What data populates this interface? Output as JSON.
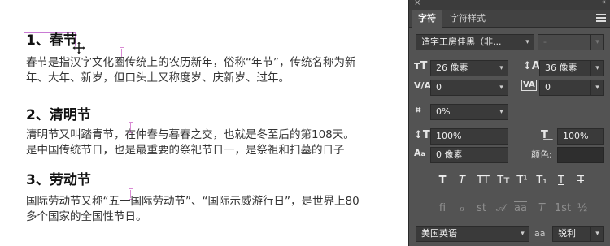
{
  "document": {
    "heading1": "1、春节",
    "para1": "春节是指汉字文化圈传统上的农历新年，俗称“年节”，传统名称为新\n年、大年、新岁，但口头上又称度岁、庆新岁、过年。",
    "heading2": "2、清明节",
    "para2": "清明节又叫踏青节，在仲春与暮春之交，也就是冬至后的第108天。\n是中国传统节日，也是最重要的祭祀节日一，是祭祖和扫墓的日子",
    "heading3": "3、劳动节",
    "para3": "国际劳动节又称“五一国际劳动节”、“国际示威游行日”，是世界上80\n多个国家的全国性节日。"
  },
  "panel": {
    "close_glyph": "×",
    "collapse_glyph": "«",
    "tabs": [
      "字符",
      "字符样式"
    ],
    "font_family": "造字工房佳黑（非...",
    "font_style": "-",
    "font_size": "26 像素",
    "leading": "36 像素",
    "kerning": "0",
    "tracking": "0",
    "tsume": "0%",
    "vertical_scale": "100%",
    "horizontal_scale": "100%",
    "baseline_shift": "0 像素",
    "color_label": "颜色:",
    "style_buttons": [
      "T",
      "T",
      "TT",
      "Tт",
      "T¹",
      "T₁",
      "T",
      "T"
    ],
    "opentype_buttons": [
      "fi",
      "ℴ",
      "st",
      "𝒜",
      "aa",
      "T",
      "1st",
      "½"
    ],
    "language": "美国英语",
    "aa_label": "aa",
    "antialias": "锐利",
    "colors": {
      "panel_bg": "#535353",
      "field_bg": "#3a3a3a",
      "selection_box": "#c97ad4"
    }
  }
}
